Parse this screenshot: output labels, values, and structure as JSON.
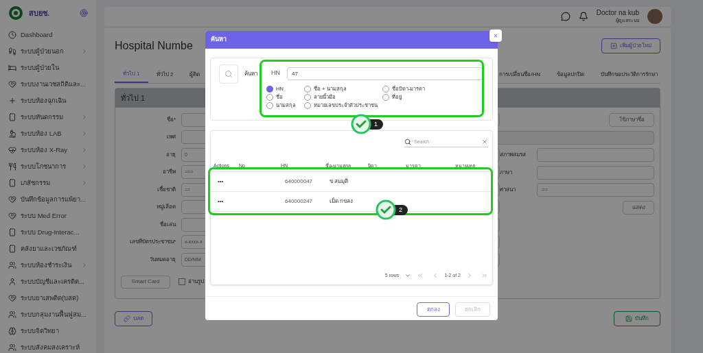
{
  "sidebar": {
    "brand": "สบยช.",
    "items": [
      {
        "label": "Dashboard",
        "has_submenu": false
      },
      {
        "label": "ระบบผู้ป่วยนอก",
        "has_submenu": true
      },
      {
        "label": "ระบบผู้ป่วยใน",
        "has_submenu": false
      },
      {
        "label": "ระบบงานเวชสถิติและ...",
        "has_submenu": false
      },
      {
        "label": "ระบบห้องฉุกเฉิน",
        "has_submenu": false
      },
      {
        "label": "ระบบทันตกรรม",
        "has_submenu": true
      },
      {
        "label": "ระบบห้อง LAB",
        "has_submenu": true
      },
      {
        "label": "ระบบห้อง X-Ray",
        "has_submenu": true
      },
      {
        "label": "ระบบโภชนาการ",
        "has_submenu": true
      },
      {
        "label": "เภสัชกรรม",
        "has_submenu": true
      },
      {
        "label": "บันทึกข้อมูลการแพ้ยา...",
        "has_submenu": false
      },
      {
        "label": "ระบบ Med Error",
        "has_submenu": false
      },
      {
        "label": "ระบบ Drug-Interac...",
        "has_submenu": false
      },
      {
        "label": "คลังยาและเวชภัณฑ์",
        "has_submenu": false
      },
      {
        "label": "ระบบห้องชำระเงิน",
        "has_submenu": true
      },
      {
        "label": "ระบบบัญชีและเครดิต...",
        "has_submenu": false
      },
      {
        "label": "ระบบยาเสพติด(บสต)",
        "has_submenu": false
      },
      {
        "label": "ระบบกลุ่มงานฟื้นฟูสม...",
        "has_submenu": false
      },
      {
        "label": "ระบบจิตวิทยา",
        "has_submenu": false
      },
      {
        "label": "ระบบสังคมสงเคราะห์",
        "has_submenu": false
      }
    ]
  },
  "topbar": {
    "user_name": "Doctor na kub",
    "user_role": "ผู้ดูแลระบบ"
  },
  "page": {
    "title": "Hospital Numbe",
    "add_button": "เพิ่มผู้ป่วยใหม่",
    "tabs_left": [
      {
        "label": "ทั่วไป 1",
        "selected": true
      },
      {
        "label": "ทั่วไป 2",
        "selected": false
      },
      {
        "label": "ผู้ติด",
        "selected": false
      }
    ],
    "tabs_right": [
      {
        "label": "การเปลี่ยนชื่อ/HN",
        "selected": false
      },
      {
        "label": "ข้อมูลปกปิด",
        "selected": false
      },
      {
        "label": "บันทึกขอประวัติการรักษา",
        "selected": false
      }
    ],
    "section_title": "ทั่วไป 1",
    "fields": [
      {
        "label": "ชื่อ*"
      },
      {
        "label": "เพศ"
      },
      {
        "label": "อายุ",
        "placeholder": "0"
      },
      {
        "label": "อาชีพ",
        "placeholder": "==="
      },
      {
        "label": "เชื้อชาติ",
        "placeholder": "=="
      },
      {
        "label": "หมู่เลือด"
      },
      {
        "label": "ชื่อเล่น"
      },
      {
        "label": "เลขที่บัตรประชาชน*",
        "placeholder": "x-xxxx-x"
      },
      {
        "label": "วันหมดอายุ",
        "placeholder": "DD/MM"
      }
    ],
    "name_button": "ใช้ภาษาชื่อ",
    "right_fields": [
      {
        "label": "สภาพสมรส"
      },
      {
        "label": "ภาษา"
      },
      {
        "label": "ศาสนา",
        "placeholder": "=="
      }
    ],
    "show_button": "แสดง",
    "smart_card_button": "Smart Card",
    "read_photo": {
      "label": "อ่านรูป",
      "checked": false
    },
    "link_button": "บสต",
    "save_button": "บันทึก"
  },
  "dialog": {
    "title": "ค้นหา",
    "close": "×",
    "search_label": "ค้นหา",
    "field_label": "HN",
    "value": "47",
    "options": [
      {
        "label": "HN",
        "selected": true
      },
      {
        "label": "ชื่อ + นามสกุล",
        "selected": false
      },
      {
        "label": "ชื่อบิดา-มารดา",
        "selected": false
      },
      {
        "label": "ชื่อ",
        "selected": false
      },
      {
        "label": "ลายนิ้วมือ",
        "selected": false
      },
      {
        "label": "ที่อยู่",
        "selected": false
      },
      {
        "label": "นามสกุล",
        "selected": false
      },
      {
        "label": "หมายเลขประจำตัวประชาชน",
        "selected": false
      }
    ],
    "table_search_placeholder": "Search",
    "columns": [
      "Actions",
      "No",
      "HN",
      "ชื่อ-นามสกุล",
      "บิดา",
      "มารดา",
      "หมายเหตุ"
    ],
    "rows": [
      {
        "actions": "•••",
        "hn": "640000047",
        "name": "ข สมมุติ"
      },
      {
        "actions": "•••",
        "hn": "640000247",
        "name": "เม็ด กขลง"
      }
    ],
    "rows_per_page": "5 rows",
    "page_info": "1-2 of 2",
    "ok_button": "ตกลง",
    "cancel_button": "ยกเลิก"
  },
  "annotations": [
    {
      "label": "1"
    },
    {
      "label": "2"
    }
  ]
}
